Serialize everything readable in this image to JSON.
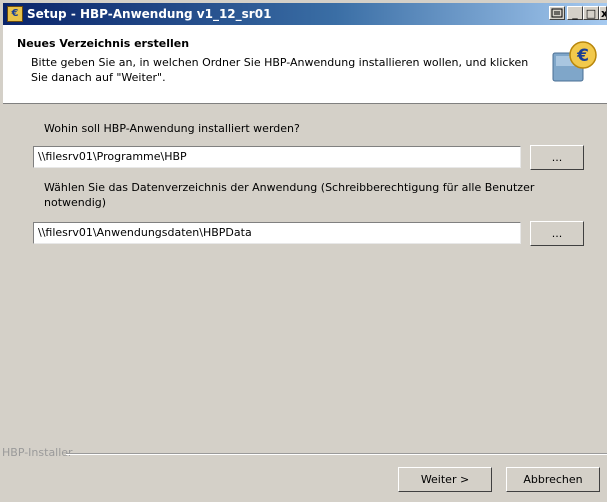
{
  "window": {
    "title": "Setup - HBP-Anwendung v1_12_sr01",
    "controls": {
      "minimize": "_",
      "maximize": "□",
      "close": "x"
    }
  },
  "header": {
    "title": "Neues Verzeichnis erstellen",
    "subtitle": "Bitte geben Sie an, in welchen Ordner Sie HBP-Anwendung installieren wollen, und klicken Sie danach auf \"Weiter\"."
  },
  "install_dir": {
    "label": "Wohin soll HBP-Anwendung installiert werden?",
    "value": "\\\\filesrv01\\Programme\\HBP",
    "browse_label": "..."
  },
  "data_dir": {
    "label": "Wählen Sie das Datenverzeichnis der Anwendung (Schreibberechtigung für alle Benutzer notwendig)",
    "value": "\\\\filesrv01\\Anwendungsdaten\\HBPData",
    "browse_label": "..."
  },
  "footer": {
    "group_label": "HBP-Installer",
    "next_label": "Weiter >",
    "cancel_label": "Abbrechen"
  }
}
